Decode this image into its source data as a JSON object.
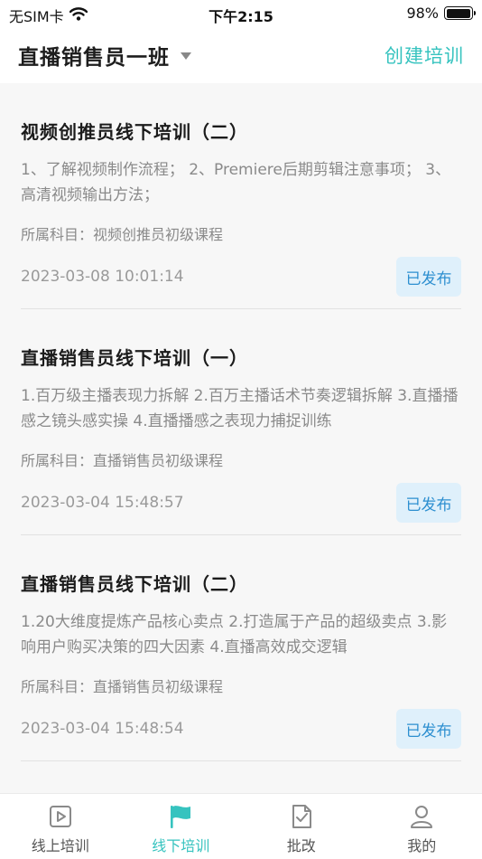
{
  "status_bar": {
    "carrier": "无SIM卡",
    "time": "下午2:15",
    "battery": "98%",
    "battery_level": 0.98
  },
  "header": {
    "class_name": "直播销售员一班",
    "create_label": "创建培训"
  },
  "trainings": [
    {
      "title": "视频创推员线下培训（二）",
      "description": "1、了解视频制作流程；  2、Premiere后期剪辑注意事项；  3、高清视频输出方法；",
      "subject": "所属科目：视频创推员初级课程",
      "date": "2023-03-08 10:01:14",
      "status": "已发布"
    },
    {
      "title": "直播销售员线下培训（一）",
      "description": "1.百万级主播表现力拆解 2.百万主播话术节奏逻辑拆解 3.直播播感之镜头感实操 4.直播播感之表现力捕捉训练",
      "subject": "所属科目：直播销售员初级课程",
      "date": "2023-03-04 15:48:57",
      "status": "已发布"
    },
    {
      "title": "直播销售员线下培训（二）",
      "description": "1.20大维度提炼产品核心卖点 2.打造属于产品的超级卖点 3.影响用户购买决策的四大因素 4.直播高效成交逻辑",
      "subject": "所属科目：直播销售员初级课程",
      "date": "2023-03-04 15:48:54",
      "status": "已发布"
    }
  ],
  "tabs": [
    {
      "label": "线上培训",
      "icon": "video-play-icon"
    },
    {
      "label": "线下培训",
      "icon": "flag-icon"
    },
    {
      "label": "批改",
      "icon": "document-check-icon"
    },
    {
      "label": "我的",
      "icon": "user-icon"
    }
  ],
  "colors": {
    "accent": "#36c3bf",
    "badge_bg": "#dff0fb",
    "badge_text": "#2d8fd0"
  }
}
